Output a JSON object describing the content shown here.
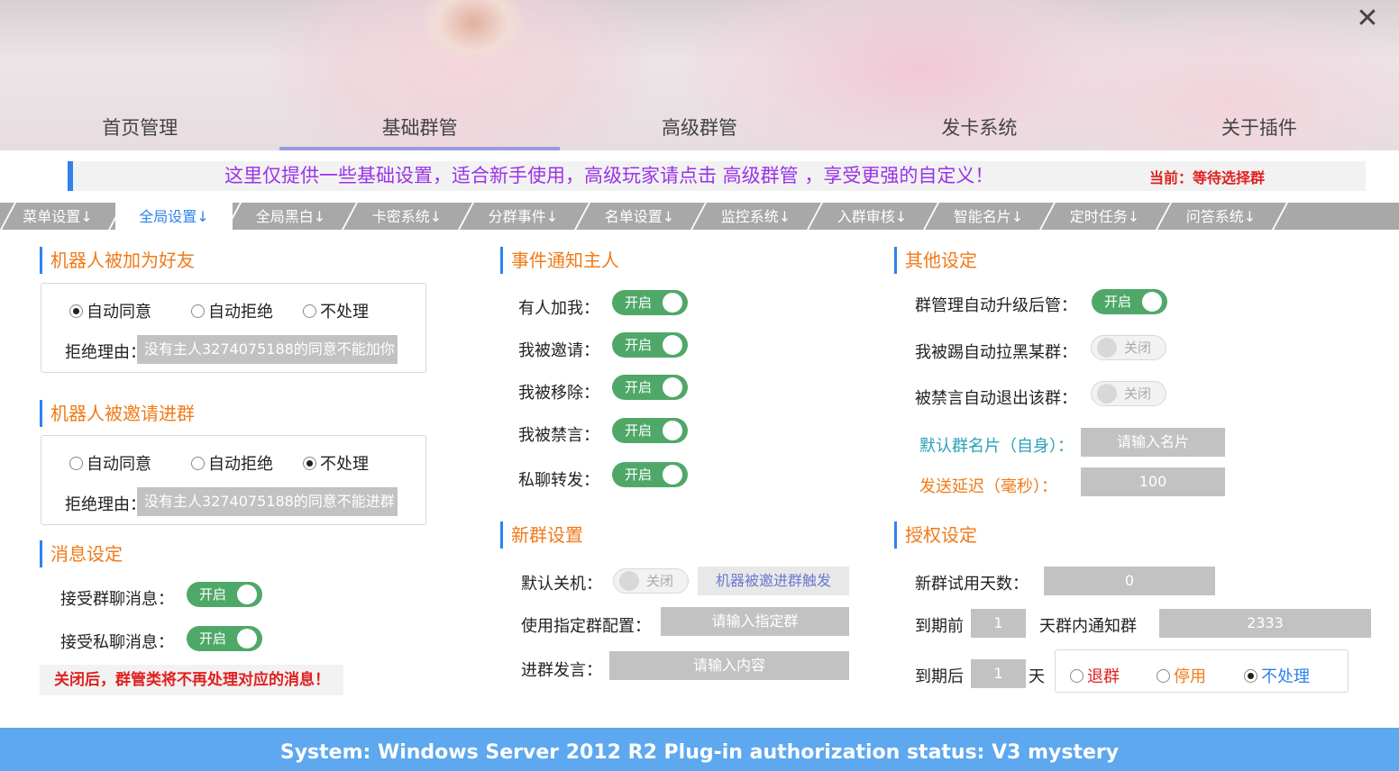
{
  "window": {
    "close_label": "✕"
  },
  "nav": {
    "items": [
      "首页管理",
      "基础群管",
      "高级群管",
      "发卡系统",
      "关于插件"
    ],
    "active": 1
  },
  "notice": {
    "text": "这里仅提供一些基础设置，适合新手使用，高级玩家请点击 高级群管 ，享受更强的自定义！",
    "current": "当前：等待选择群"
  },
  "tabs": [
    "菜单设置↓",
    "全局设置↓",
    "全局黑白↓",
    "卡密系统↓",
    "分群事件↓",
    "名单设置↓",
    "监控系统↓",
    "入群审核↓",
    "智能名片↓",
    "定时任务↓",
    "问答系统↓"
  ],
  "friend": {
    "title": "机器人被加为好友",
    "options": [
      "自动同意",
      "自动拒绝",
      "不处理"
    ],
    "selected": 0,
    "reason_label": "拒绝理由：",
    "reason_value": "没有主人3274075188的同意不能加你"
  },
  "invite": {
    "title": "机器人被邀请进群",
    "options": [
      "自动同意",
      "自动拒绝",
      "不处理"
    ],
    "selected": 2,
    "reason_label": "拒绝理由：",
    "reason_value": "没有主人3274075188的同意不能进群"
  },
  "message": {
    "title": "消息设定",
    "group_label": "接受群聊消息：",
    "group_state": "开启",
    "private_label": "接受私聊消息：",
    "private_state": "开启",
    "warning": "关闭后，群管类将不再处理对应的消息！"
  },
  "events": {
    "title": "事件通知主人",
    "items": [
      {
        "label": "有人加我：",
        "state": "开启"
      },
      {
        "label": "我被邀请：",
        "state": "开启"
      },
      {
        "label": "我被移除：",
        "state": "开启"
      },
      {
        "label": "我被禁言：",
        "state": "开启"
      },
      {
        "label": "私聊转发：",
        "state": "开启"
      }
    ]
  },
  "newgroup": {
    "title": "新群设置",
    "default_off_label": "默认关机：",
    "default_off_state": "关闭",
    "trigger_button": "机器被邀进群触发",
    "config_label": "使用指定群配置：",
    "config_placeholder": "请输入指定群",
    "speech_label": "进群发言：",
    "speech_placeholder": "请输入内容"
  },
  "other": {
    "title": "其他设定",
    "items": [
      {
        "label": "群管理自动升级后管：",
        "state": "开启"
      },
      {
        "label": "我被踢自动拉黑某群：",
        "state": "关闭"
      },
      {
        "label": "被禁言自动退出该群：",
        "state": "关闭"
      }
    ],
    "card_label": "默认群名片（自身）：",
    "card_placeholder": "请输入名片",
    "delay_label": "发送延迟（毫秒）：",
    "delay_value": "100"
  },
  "auth": {
    "title": "授权设定",
    "trial_label": "新群试用天数：",
    "trial_value": "0",
    "before_label": "到期前",
    "before_value": "1",
    "notify_label": "天群内通知群",
    "notify_value": "2333",
    "after_label": "到期后",
    "after_value": "1",
    "day_label": "天",
    "options": [
      "退群",
      "停用",
      "不处理"
    ],
    "selected": 2
  },
  "footer": {
    "text": "System:  Windows Server 2012 R2  Plug-in authorization status:  V3 mystery"
  },
  "colors": {
    "accent": "#2f82ee",
    "orange": "#f07a18",
    "toggle_on": "#4fa868",
    "footer": "#5da8ef",
    "purple_notice": "#9b33e8"
  }
}
